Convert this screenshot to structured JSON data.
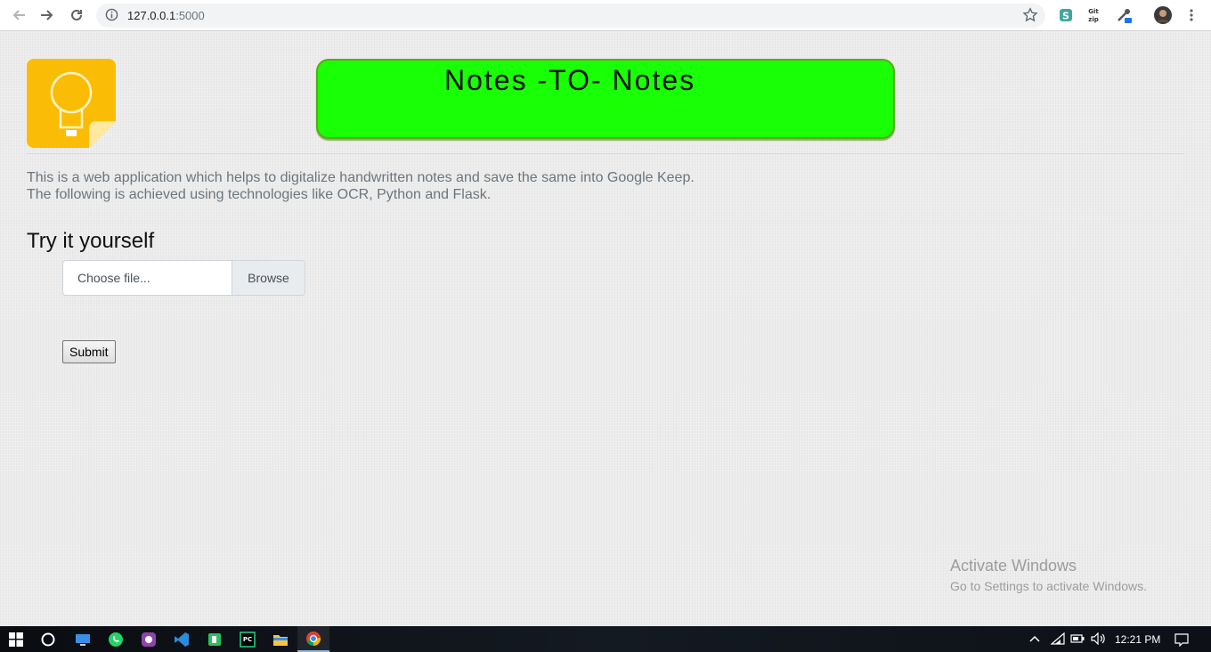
{
  "browser": {
    "url_host": "127.0.0.1",
    "url_port": ":5000",
    "extensions": [
      "s-extension-icon",
      "gitzip-icon",
      "eyedropper-icon"
    ],
    "gitzip_label": "Git zip"
  },
  "page": {
    "banner_title": "Notes -TO- Notes",
    "description_line1": "This is a web application which helps to digitalize handwritten notes and save the same into Google Keep.",
    "description_line2": "The following is achieved using technologies like OCR, Python and Flask.",
    "try_heading": "Try it yourself",
    "file_input": {
      "placeholder": "Choose file...",
      "browse_label": "Browse"
    },
    "submit_label": "Submit",
    "colors": {
      "banner": "#19ff05",
      "logo": "#fbbc05"
    }
  },
  "watermark": {
    "title": "Activate Windows",
    "subtitle": "Go to Settings to activate Windows."
  },
  "taskbar": {
    "apps": [
      "start-icon",
      "cortana-icon",
      "taskview-icon",
      "whatsapp-icon",
      "app-icon",
      "vscode-icon",
      "evernote-icon",
      "pycharm-icon",
      "file-explorer-icon",
      "chrome-icon"
    ],
    "clock": "12:21 PM"
  }
}
